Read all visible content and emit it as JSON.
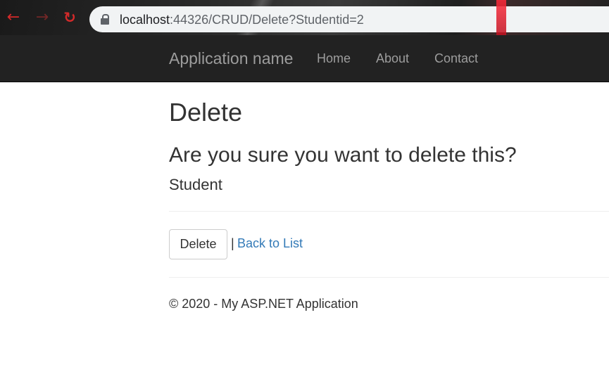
{
  "browser": {
    "url_host": "localhost",
    "url_rest": ":44326/CRUD/Delete?Studentid=2",
    "back_icon": "←",
    "forward_icon": "→",
    "reload_icon": "↻"
  },
  "navbar": {
    "brand": "Application name",
    "links": [
      "Home",
      "About",
      "Contact"
    ]
  },
  "main": {
    "title": "Delete",
    "question": "Are you sure you want to delete this?",
    "entity": "Student",
    "delete_label": "Delete",
    "separator": "|",
    "back_link": "Back to List"
  },
  "footer": {
    "text": "© 2020 - My ASP.NET Application"
  },
  "colors": {
    "navbar_bg": "#222222",
    "link": "#337ab7",
    "text": "#333333"
  }
}
